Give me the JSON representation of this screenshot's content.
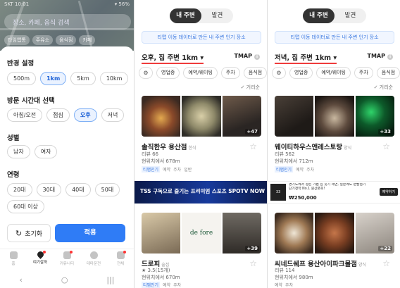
{
  "left_panel": {
    "status_left": "SKT 10:01",
    "status_right": "▾ 56%",
    "search_placeholder": "장소, 카페, 음식 검색",
    "map_chips": [
      "타임앱통",
      "주유소",
      "음식점",
      "카페"
    ],
    "radius": {
      "title": "반경 설정",
      "options": [
        "500m",
        "1km",
        "5km",
        "10km"
      ],
      "selected": "1km"
    },
    "visit_time": {
      "title": "방문 시간대 선택",
      "options": [
        "아침/오전",
        "점심",
        "오후",
        "저녁"
      ],
      "selected": "오후"
    },
    "gender": {
      "title": "성별",
      "options": [
        "남자",
        "여자"
      ]
    },
    "age": {
      "title": "연령",
      "options": [
        "20대",
        "30대",
        "40대",
        "50대",
        "60대 이상"
      ]
    },
    "reset_label": "초기화",
    "apply_label": "적용",
    "tabs": [
      "홈",
      "여기갈까",
      "커뮤니티",
      "테마운전",
      "전체"
    ],
    "nav": [
      "‹",
      "○",
      "|||"
    ]
  },
  "mid_panel": {
    "seg_nearby": "내 주변",
    "seg_discover": "발견",
    "banner": "티맵 이동 데이터로 만든 내 주변 인기 장소",
    "filter_title": "오후, 집 주변 1km ▾",
    "tmap_label": "TMAP",
    "chips": [
      "영업중",
      "예약/웨이팅",
      "주차",
      "음식점"
    ],
    "sort_label": "✓ 거리순",
    "restaurants": [
      {
        "name": "솔직한우 용산점",
        "category": "한식",
        "line1": "리뷰 66",
        "line2": "현위치에서 678m",
        "tags": [
          "티맵인기",
          "예약",
          "주차",
          "일반"
        ],
        "photo_count": "+47"
      },
      {
        "name": "드로피",
        "category": "술집",
        "line1": "★ 3.5(15개)",
        "line2": "현위치에서 670m",
        "tags": [
          "티맵인기",
          "예약",
          "주차"
        ],
        "photo_count": "+39"
      }
    ],
    "ad_text": "TSS 구독으로 즐기는 프리미엄 스포츠 SPOTV NOW"
  },
  "right_panel": {
    "seg_nearby": "내 주변",
    "seg_discover": "발견",
    "banner": "티맵 이동 데이터로 만든 내 주변 인기 장소",
    "filter_title": "저녁, 집 주변 1km ▾",
    "tmap_label": "TMAP",
    "chips": [
      "영업중",
      "예약/웨이팅",
      "주차",
      "음식점"
    ],
    "sort_label": "✓ 거리순",
    "restaurants": [
      {
        "name": "웨이티하우스앤레스토랑",
        "category": "양식",
        "line1": "리뷰 562",
        "line2": "현위치에서 712m",
        "tags": [
          "티맵인기",
          "예약",
          "주차"
        ],
        "photo_count": "+33"
      },
      {
        "name": "씨네드쉐프 용산아이파크몰점",
        "category": "양식",
        "line1": "리뷰 114",
        "line2": "현위치에서 980m",
        "tags": [
          "예약",
          "주차"
        ],
        "photo_count": "+22"
      }
    ],
    "ad_text": "경기도에서 정든 가볍 집 짓기 세면, 일본에도 편발접기 단기청약 No.1 원상폰회!",
    "ad_price": "₩250,000",
    "ad_button": "예약하기"
  },
  "colors": {
    "accent": "#2f7cf6",
    "underline": "#ef3b3b"
  }
}
